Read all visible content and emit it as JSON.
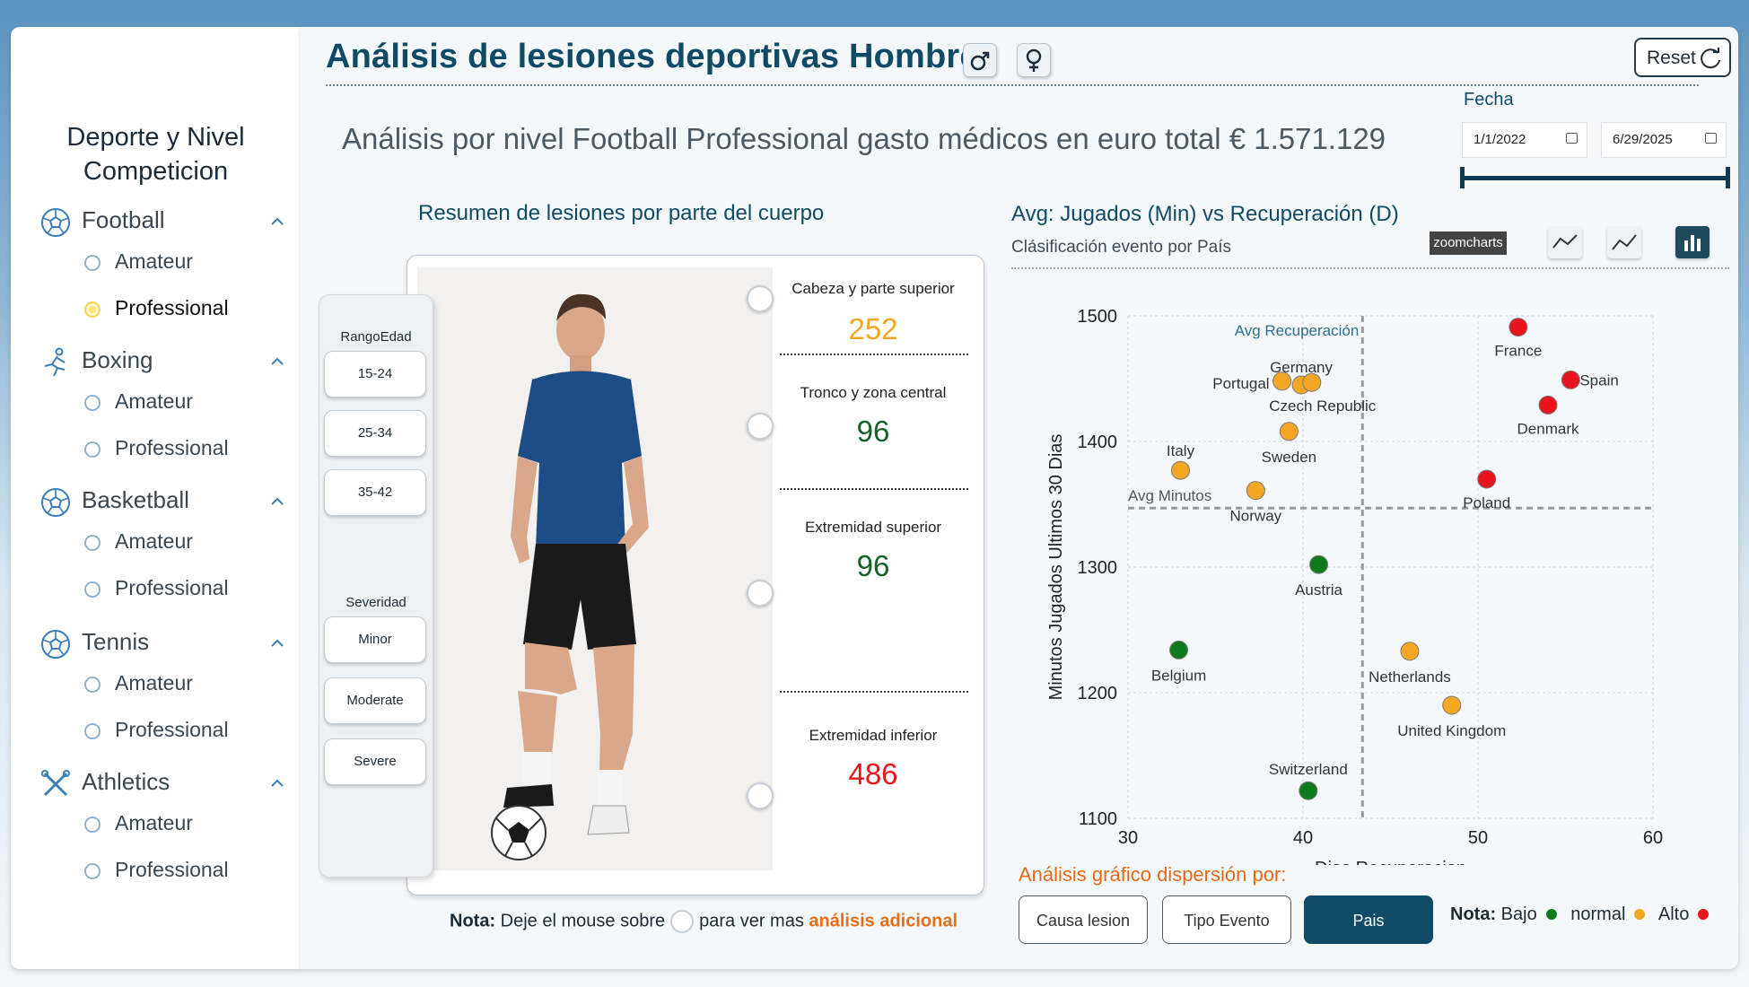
{
  "sidebar": {
    "title": "Deporte y Nivel Competicion",
    "sports": [
      {
        "label": "Football",
        "icon": "soccer-ball-icon",
        "options": [
          "Amateur",
          "Professional"
        ],
        "selected": "Professional"
      },
      {
        "label": "Boxing",
        "icon": "runner-icon",
        "options": [
          "Amateur",
          "Professional"
        ],
        "selected": ""
      },
      {
        "label": "Basketball",
        "icon": "soccer-ball-icon",
        "options": [
          "Amateur",
          "Professional"
        ],
        "selected": ""
      },
      {
        "label": "Tennis",
        "icon": "soccer-ball-icon",
        "options": [
          "Amateur",
          "Professional"
        ],
        "selected": ""
      },
      {
        "label": "Athletics",
        "icon": "tools-icon",
        "options": [
          "Amateur",
          "Professional"
        ],
        "selected": ""
      }
    ]
  },
  "header": {
    "title": "Análisis de lesiones deportivas Hombres",
    "male_icon": "male-symbol-icon",
    "female_icon": "female-symbol-icon",
    "reset_label": "Reset"
  },
  "summary": {
    "subtitle": "Análisis por nivel Football Professional gasto médicos en euro total € 1.571.129"
  },
  "date_filter": {
    "label": "Fecha",
    "start": "1/1/2022",
    "end": "6/29/2025"
  },
  "body_panel": {
    "title": "Resumen de lesiones por parte del cuerpo",
    "filters": {
      "age_label": "RangoEdad",
      "ages": [
        "15-24",
        "25-34",
        "35-42"
      ],
      "severity_label": "Severidad",
      "severities": [
        "Minor",
        "Moderate",
        "Severe"
      ]
    },
    "stats": [
      {
        "label": "Cabeza y parte superior",
        "value": "252",
        "color": "#f5a623"
      },
      {
        "label": "Tronco y zona central",
        "value": "96",
        "color": "#17612a"
      },
      {
        "label": "Extremidad superior",
        "value": "96",
        "color": "#17612a"
      },
      {
        "label": "Extremidad inferior",
        "value": "486",
        "color": "#e8141e"
      }
    ],
    "note": {
      "bold": "Nota:",
      "before": "Deje el mouse sobre",
      "after": "para ver mas",
      "highlight": "análisis adicional"
    }
  },
  "scatter": {
    "title": "Avg: Jugados (Min) vs Recuperación (D)",
    "subtitle": "Clásificación evento por País",
    "brand": "zoomcharts",
    "dispersion_title": "Análisis gráfico dispersión por:",
    "dispersion_buttons": [
      "Causa lesion",
      "Tipo Evento",
      "Pais"
    ],
    "active_button": "Pais",
    "legend": {
      "bold": "Nota:",
      "items": [
        {
          "label": "Bajo",
          "color": "#0e7a1e"
        },
        {
          "label": "normal",
          "color": "#f5a623"
        },
        {
          "label": "Alto",
          "color": "#e8141e"
        }
      ]
    }
  },
  "chart_data": {
    "type": "scatter",
    "xlabel": "Dias Recuperacion",
    "ylabel": "Minutos Jugados Ultimos 30 Dias",
    "xlim": [
      30,
      60
    ],
    "ylim": [
      1100,
      1500
    ],
    "xticks": [
      "30",
      "40",
      "50",
      "60"
    ],
    "yticks": [
      "1100",
      "1200",
      "1300",
      "1400",
      "1500"
    ],
    "avg_x": 43.4,
    "avg_x_label": "Avg Recuperación",
    "avg_y": 1347,
    "avg_y_label": "Avg Minutos",
    "grid": true,
    "points": [
      {
        "name": "France",
        "x": 52.3,
        "y": 1491,
        "level": "Alto"
      },
      {
        "name": "Spain",
        "x": 55.3,
        "y": 1449,
        "level": "Alto"
      },
      {
        "name": "Denmark",
        "x": 54.0,
        "y": 1429,
        "level": "Alto"
      },
      {
        "name": "Poland",
        "x": 50.5,
        "y": 1370,
        "level": "Alto"
      },
      {
        "name": "Germany",
        "x": 39.9,
        "y": 1445,
        "level": "normal"
      },
      {
        "name": "Portugal",
        "x": 38.8,
        "y": 1448,
        "level": "normal"
      },
      {
        "name": "Czech Republic",
        "x": 40.5,
        "y": 1447,
        "level": "normal"
      },
      {
        "name": "Sweden",
        "x": 39.2,
        "y": 1408,
        "level": "normal"
      },
      {
        "name": "Italy",
        "x": 33.0,
        "y": 1377,
        "level": "normal"
      },
      {
        "name": "Norway",
        "x": 37.3,
        "y": 1361,
        "level": "normal"
      },
      {
        "name": "Netherlands",
        "x": 46.1,
        "y": 1233,
        "level": "normal"
      },
      {
        "name": "United Kingdom",
        "x": 48.5,
        "y": 1190,
        "level": "normal"
      },
      {
        "name": "Austria",
        "x": 40.9,
        "y": 1302,
        "level": "Bajo"
      },
      {
        "name": "Belgium",
        "x": 32.9,
        "y": 1234,
        "level": "Bajo"
      },
      {
        "name": "Switzerland",
        "x": 40.3,
        "y": 1122,
        "level": "Bajo"
      }
    ],
    "colors": {
      "Bajo": "#0e7a1e",
      "normal": "#f5a623",
      "Alto": "#e8141e"
    }
  }
}
